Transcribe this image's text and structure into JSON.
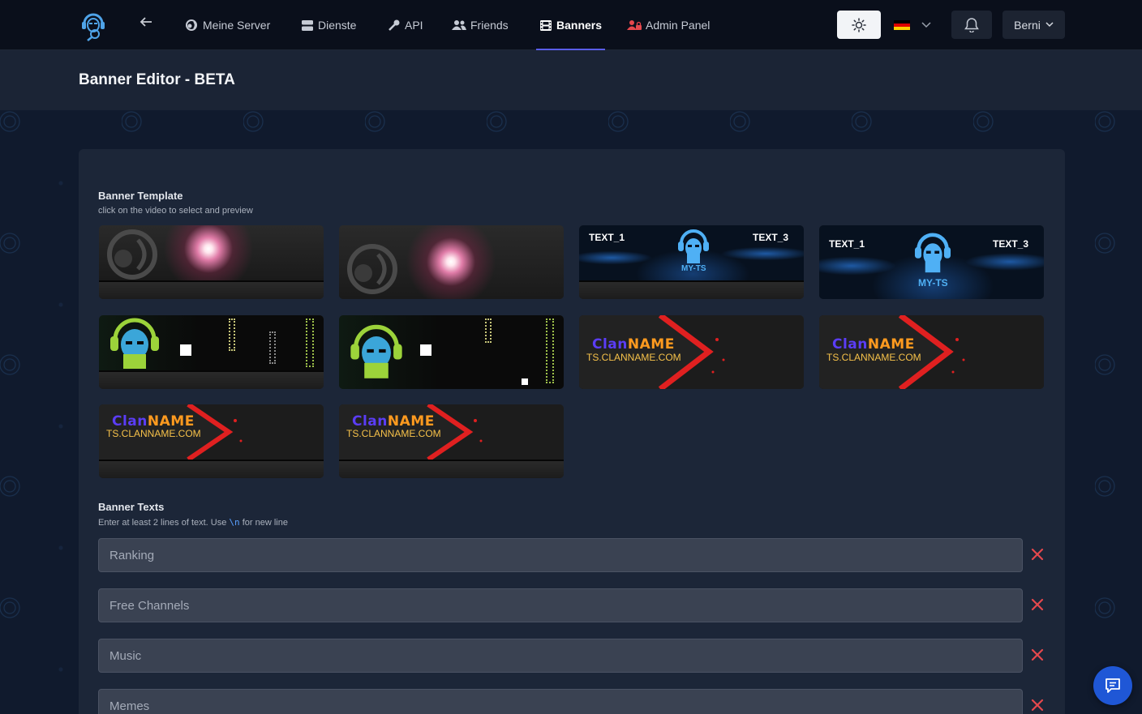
{
  "nav": {
    "items": [
      {
        "label": "Meine Server",
        "icon": "teamspeak-icon"
      },
      {
        "label": "Dienste",
        "icon": "server-icon"
      },
      {
        "label": "API",
        "icon": "key-icon"
      },
      {
        "label": "Friends",
        "icon": "users-icon"
      },
      {
        "label": "Banners",
        "icon": "film-icon",
        "active": true
      },
      {
        "label": "Admin Panel",
        "icon": "user-lock-icon"
      }
    ],
    "user_label": "Berni",
    "language": "de"
  },
  "page": {
    "title": "Banner Editor - BETA"
  },
  "templates": {
    "title": "Banner Template",
    "subtitle": "click on the video to select and preview",
    "items": [
      {
        "kind": "flare",
        "text1": "",
        "text3": ""
      },
      {
        "kind": "flare",
        "text1": "",
        "text3": ""
      },
      {
        "kind": "particles",
        "text1": "TEXT_1",
        "text3": "TEXT_3",
        "brand": "MY-TS"
      },
      {
        "kind": "particles",
        "text1": "TEXT_1",
        "text3": "TEXT_3",
        "brand": "MY-TS"
      },
      {
        "kind": "pixel",
        "text1": "",
        "text3": ""
      },
      {
        "kind": "pixel",
        "text1": "",
        "text3": ""
      },
      {
        "kind": "clan",
        "clan_a": "Clan",
        "clan_b": "NAME",
        "url": "TS.CLANNAME.COM"
      },
      {
        "kind": "clan",
        "clan_a": "Clan",
        "clan_b": "NAME",
        "url": "TS.CLANNAME.COM"
      },
      {
        "kind": "clan",
        "clan_a": "Clan",
        "clan_b": "NAME",
        "url": "TS.CLANNAME.COM"
      },
      {
        "kind": "clan",
        "clan_a": "Clan",
        "clan_b": "NAME",
        "url": "TS.CLANNAME.COM"
      }
    ]
  },
  "texts": {
    "title": "Banner Texts",
    "subtitle_pre": "Enter at least 2 lines of text. Use",
    "subtitle_code": "\\n",
    "subtitle_post": "for new line",
    "lines": [
      {
        "placeholder": "Ranking"
      },
      {
        "placeholder": "Free Channels"
      },
      {
        "placeholder": "Music"
      },
      {
        "placeholder": "Memes"
      }
    ]
  },
  "colors": {
    "accent": "#5a5de8",
    "remove": "#e5484d",
    "chat": "#1f57d6"
  }
}
